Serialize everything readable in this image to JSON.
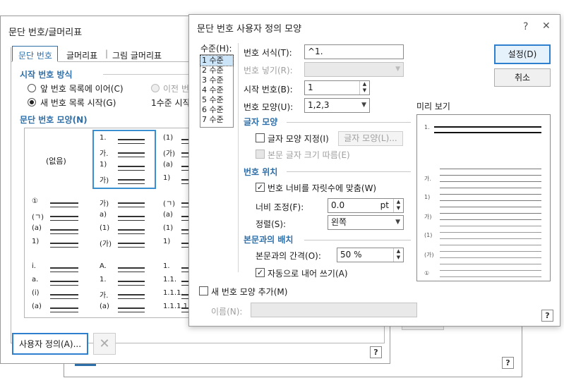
{
  "back_dialog": {
    "title": "문단 번호/글머리표",
    "tabs": [
      "문단 번호",
      "글머리표",
      "그림 글머리표"
    ],
    "start_section": "시작 번호 방식",
    "radio_continue": "앞 번호 목록에 이어(C)",
    "radio_prev": "이전 번",
    "radio_new": "새 번호 목록 시작(G)",
    "level_start": "1수준 시작",
    "shape_section": "문단 번호 모양(N)",
    "none_label": "(없음)",
    "cells": [
      [
        "1.",
        "가.",
        "1)",
        "가)"
      ],
      [
        "(1)",
        "(가)",
        "(a)",
        "1)"
      ],
      [
        "①",
        "(ㄱ)",
        "(a)",
        "1)"
      ],
      [
        "가)",
        "a)",
        "(1)",
        "(가)"
      ],
      [
        "(ㄱ)",
        "(a)",
        "(1)",
        "1)"
      ],
      [
        "i.",
        "a.",
        "(i)",
        "(a)"
      ],
      [
        "A.",
        "1.",
        "가.",
        "(a)"
      ],
      [
        "1.",
        "1.1.",
        "1.1.1.",
        "1.1.1.1."
      ]
    ],
    "custom_button": "사용자 정의(A)...",
    "delete_icon": "x-icon",
    "help": "?"
  },
  "third_dialog": {
    "help": "?"
  },
  "front_dialog": {
    "title": "문단 번호 사용자 정의 모양",
    "help_icon": "?",
    "close_icon": "✕",
    "level_label": "수준(H):",
    "levels": [
      "1 수준",
      "2 수준",
      "3 수준",
      "4 수준",
      "5 수준",
      "6 수준",
      "7 수준"
    ],
    "format_label": "번호 서식(T):",
    "format_value": "^1.",
    "insert_label": "번호 넣기(R):",
    "start_label": "시작 번호(B):",
    "start_value": "1",
    "shape_label": "번호 모양(U):",
    "shape_value": "1,2,3",
    "char_section": "글자 모양",
    "char_set_label": "글자 모양 지정(I)",
    "char_button": "글자 모양(L)...",
    "body_size_label": "본문 글자 크기 따름(E)",
    "pos_section": "번호 위치",
    "fit_label": "번호 너비를 자릿수에 맞춤(W)",
    "width_label": "너비 조정(F):",
    "width_value": "0.0",
    "width_unit": "pt",
    "align_label": "정렬(S):",
    "align_value": "왼쪽",
    "body_section": "본문과의 배치",
    "gap_label": "본문과의 간격(O):",
    "gap_value": "50 %",
    "auto_indent_label": "자동으로 내어 쓰기(A)",
    "add_shape_label": "새 번호 모양 추가(M)",
    "name_label": "이름(N):",
    "ok_button": "설정(D)",
    "cancel_button": "취소",
    "preview_label": "미리 보기",
    "preview_markers": [
      "1.",
      "가.",
      "1)",
      "가)",
      "(1)",
      "(가)",
      "①"
    ]
  }
}
